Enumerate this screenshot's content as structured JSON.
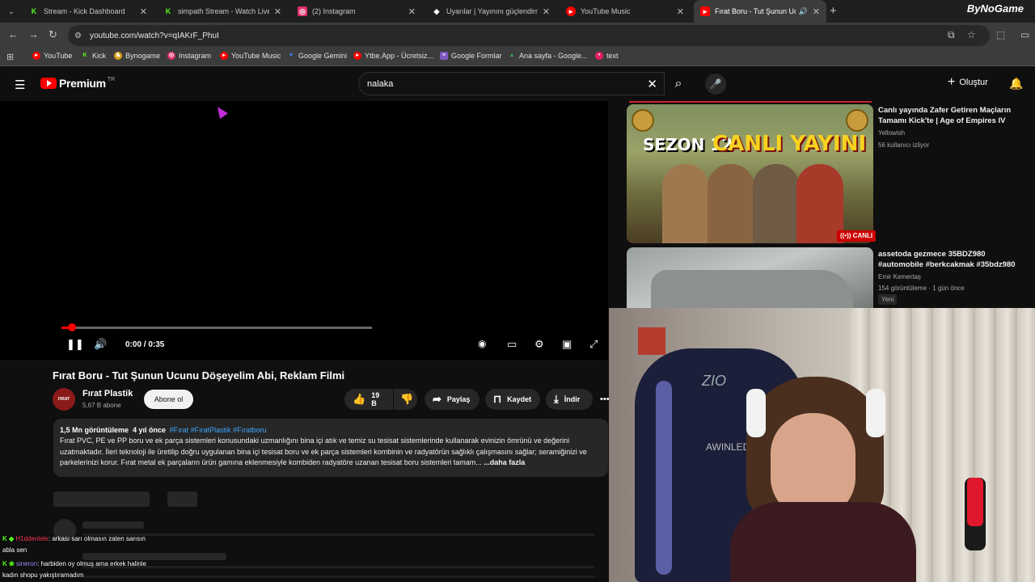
{
  "browser": {
    "tabs": [
      {
        "title": "Stream - Kick Dashboard",
        "icon": "kick-icon",
        "color": "#53fc18",
        "active": false
      },
      {
        "title": "simpath Stream - Watch Live on Kick",
        "icon": "kick-icon",
        "color": "#53fc18",
        "active": false
      },
      {
        "title": "(2) Instagram",
        "icon": "instagram-icon",
        "color": "#e1306c",
        "active": false
      },
      {
        "title": "Uyarılar | Yayınını güçlendirmek",
        "icon": "streamlabs-icon",
        "color": "#ffffff",
        "active": false
      },
      {
        "title": "YouTube Music",
        "icon": "youtube-music-icon",
        "color": "#ff0000",
        "active": false
      },
      {
        "title": "Fırat Boru - Tut Şunun Ucunu",
        "icon": "youtube-icon",
        "color": "#ff0000",
        "active": true
      }
    ],
    "brand_watermark": "ByNoGame",
    "url": "youtube.com/watch?v=qIAKrF_PhuI",
    "bookmarks": [
      {
        "label": "YouTube",
        "color": "#ff0000"
      },
      {
        "label": "Kick",
        "color": "#53fc18"
      },
      {
        "label": "Bynogame",
        "color": "#d4a017"
      },
      {
        "label": "Instagram",
        "color": "#e1306c"
      },
      {
        "label": "YouTube Music",
        "color": "#ff0000"
      },
      {
        "label": "Google Gemini",
        "color": "#4285f4"
      },
      {
        "label": "Ytbe.App - Ücretsiz...",
        "color": "#ff0000"
      },
      {
        "label": "Google Formlar",
        "color": "#7e57c2"
      },
      {
        "label": "Ana sayfa - Google...",
        "color": "#34a853"
      },
      {
        "label": "text",
        "color": "#e91e63"
      }
    ]
  },
  "youtube": {
    "logo_text": "Premium",
    "country": "TR",
    "search_query": "nalaka",
    "create_label": "Oluştur",
    "player": {
      "time_display": "0:00 / 0:35",
      "progress_fraction": 0.0,
      "buffered_fraction": 0.5
    },
    "video": {
      "title": "Fırat Boru - Tut Şunun Ucunu Döşeyelim Abi, Reklam Filmi",
      "channel": "Fırat Plastik",
      "avatar_text": "FIRAT",
      "subscribers": "5,67 B abone",
      "subscribe_label": "Abone ol",
      "likes": "19 B",
      "share_label": "Paylaş",
      "save_label": "Kaydet",
      "download_label": "İndir",
      "views": "1,5 Mn görüntüleme",
      "age": "4 yıl önce",
      "tags": "#Fırat #FıratPlastik #Fıratboru",
      "description": "Fırat PVC, PE ve PP boru ve ek parça sistemleri konusundaki uzmanlığını bina içi atık ve temiz su tesisat sistemlerinde kullanarak evinizin ömrünü ve değerini uzatmaktadır. İleri teknoloji ile üretilip doğru uygulanan bina içi tesisat boru ve ek parça sistemleri kombinin ve radyatörün sağlıklı çalışmasını sağlar; seramiğinizi ve parkelerinizi korur. Fırat metal ek parçaların ürün gamına eklenmesiyle kombiden radyatöre uzanan tesisat boru sistemleri tamam...",
      "more_label": "...daha fazla"
    },
    "recommendations": [
      {
        "thumb_text_1": "SEZON 12",
        "thumb_text_2": "CANLI YAYINI",
        "live_badge": "CANLI",
        "title": "Canlı yayında Zafer Getiren Maçların Tamamı Kick'te | Age of Empires IV",
        "channel": "Yellowish",
        "meta": "56 kullanıcı izliyor"
      },
      {
        "title": "assetoda gezmece 35BDZ980 #automobile #berkcakmak #35bdz980",
        "channel": "Emir Kemertaş",
        "meta": "154 görüntüleme · 1 gün önce",
        "badge": "Yeni"
      }
    ]
  },
  "chat": [
    {
      "user": "H1ddenlele",
      "message": ": arkası sarı olmasın zaten sarısın"
    },
    {
      "user": "",
      "message": "abla sen"
    },
    {
      "user": "sineron",
      "message": ": harbiden oy olmuş ama erkek halinle"
    },
    {
      "user": "",
      "message": "kadın shopu yakıştıramadım"
    }
  ],
  "webcam": {
    "chair_brand": "ZIO",
    "chair_text": "AWINLED"
  }
}
